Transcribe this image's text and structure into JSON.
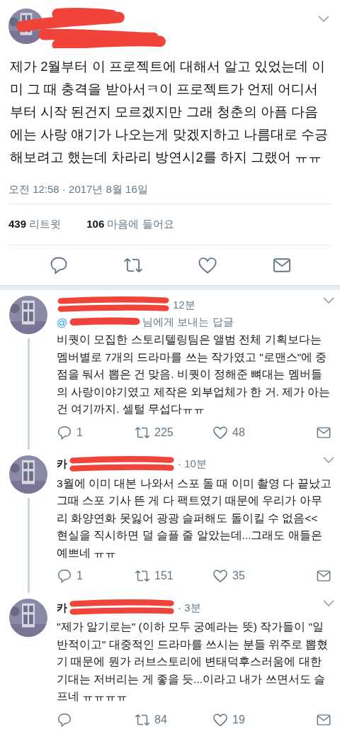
{
  "tweet": {
    "text": "제가 2월부터 이 프로젝트에 대해서 알고 있었는데 이미 그 때 충격을 받아서ㅋ이 프로젝트가 언제 어디서부터 시작 된건지 모르겠지만 그래 청춘의 아픔 다음에는 사랑 얘기가 나오는게 맞겠지하고 나름대로 수긍해보려고 했는데 차라리 방연시2를 하지 그랬어 ㅠㅠ",
    "time": "오전 12:58 · 2017년 8월 16일",
    "retweets": {
      "count": "439",
      "label": "리트윗"
    },
    "likes": {
      "count": "106",
      "label": "마음에 들어요"
    }
  },
  "replies": [
    {
      "time": "12분",
      "handle": "@",
      "reply_to": "님에게 보내는 답글",
      "text": "비퀏이 모집한 스토리텔링팀은 앨범 전체 기획보다는 멤버별로 7개의 드라마를 쓰는 작가였고 \"로맨스\"에 중점을 둬서 뽑은 건 맞음. 비퀏이 정해준 뼈대는 멤버들의 사랑이야기였고 제작은 외부업체가 한 거. 제가 아는 건 여기까지. 셀털 무섭다ㅠㅠ",
      "counts": {
        "reply": "1",
        "retweet": "225",
        "like": "48"
      }
    },
    {
      "name": "카",
      "time": "· 10분",
      "text": "3월에 이미 대본 나와서 스포 돌 때 이미 촬영 다 끝났고 그때 스포 기사 뜬 게 다 팩트였기 때문에 우리가 아무리 화양연화 못잃어 광광 슬퍼해도 돌이킬 수 없음<< 현실을 직시하면 덜 슬플 줄 알았는데...그래도 애들은 예쁘네 ㅠㅠ",
      "counts": {
        "reply": "1",
        "retweet": "151",
        "like": "35"
      }
    },
    {
      "name": "카",
      "time": "· 3분",
      "text": "\"제가 알기로는\" (이하 모두 궁예라는 뜻) 작가들이 \"일반적이고\" 대중적인 드라마를 쓰시는 분들 위주로 뽑혔기 때문에 뭔가 러브스토리에 변태덕후스러움에 대한 기대는 저버리는 게 좋을 듯...이라고 내가 쓰면서도 슬프네 ㅠㅠㅠㅠ",
      "counts": {
        "retweet": "84",
        "like": "19"
      }
    }
  ]
}
